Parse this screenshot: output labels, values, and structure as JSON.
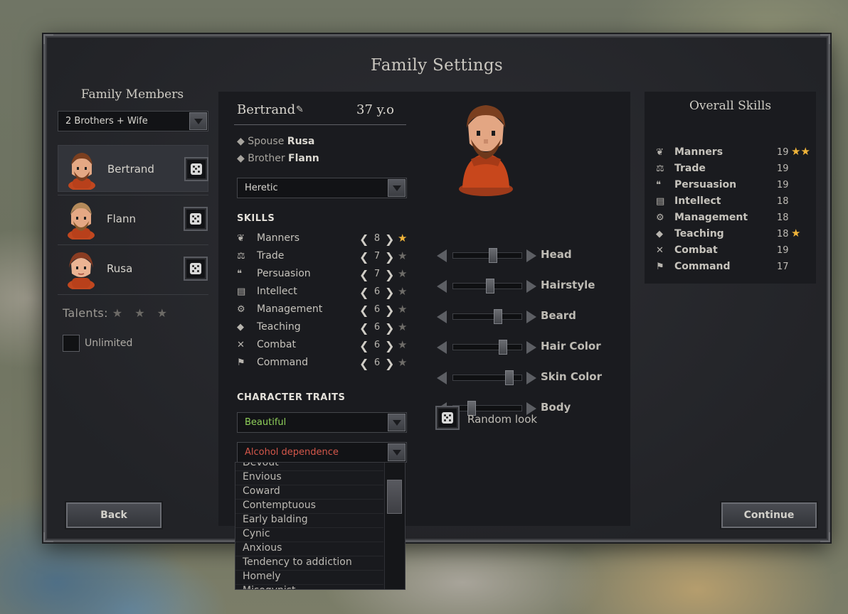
{
  "dialog": {
    "title": "Family Settings"
  },
  "family": {
    "header": "Family Members",
    "preset": "2 Brothers + Wife",
    "members": [
      {
        "name": "Bertrand",
        "active": true
      },
      {
        "name": "Flann",
        "active": false
      },
      {
        "name": "Rusa",
        "active": false
      }
    ],
    "talents_label": "Talents:",
    "talents_stars": "★ ★ ★",
    "unlimited_label": "Unlimited",
    "unlimited_checked": false
  },
  "character": {
    "name": "Bertrand",
    "age": "37 y.o",
    "relations": [
      {
        "role": "Spouse",
        "name": "Rusa"
      },
      {
        "role": "Brother",
        "name": "Flann"
      }
    ],
    "religion": "Heretic",
    "skills_header": "SKILLS",
    "skills": [
      {
        "name": "Manners",
        "icon": "manners-icon",
        "value": "8",
        "starred": true
      },
      {
        "name": "Trade",
        "icon": "trade-icon",
        "value": "7",
        "starred": false
      },
      {
        "name": "Persuasion",
        "icon": "persuasion-icon",
        "value": "7",
        "starred": false
      },
      {
        "name": "Intellect",
        "icon": "intellect-icon",
        "value": "6",
        "starred": false
      },
      {
        "name": "Management",
        "icon": "management-icon",
        "value": "6",
        "starred": false
      },
      {
        "name": "Teaching",
        "icon": "teaching-icon",
        "value": "6",
        "starred": false
      },
      {
        "name": "Combat",
        "icon": "combat-icon",
        "value": "6",
        "starred": false
      },
      {
        "name": "Command",
        "icon": "command-icon",
        "value": "6",
        "starred": false
      }
    ],
    "traits_header": "CHARACTER TRAITS",
    "trait1": "Beautiful",
    "trait2": "Alcohol dependence",
    "trait_options": [
      "Devout",
      "Envious",
      "Coward",
      "Contemptuous",
      "Early balding",
      "Cynic",
      "Anxious",
      "Tendency to addiction",
      "Homely",
      "Misogynist"
    ]
  },
  "appearance": {
    "sliders": [
      {
        "label": "Head",
        "level": 0.58
      },
      {
        "label": "Hairstyle",
        "level": 0.54
      },
      {
        "label": "Beard",
        "level": 0.65
      },
      {
        "label": "Hair Color",
        "level": 0.72
      },
      {
        "label": "Skin Color",
        "level": 0.82
      },
      {
        "label": "Body",
        "level": 0.28
      }
    ],
    "random_label": "Random look"
  },
  "overall": {
    "header": "Overall Skills",
    "skills": [
      {
        "name": "Manners",
        "value": "19",
        "stars": 2
      },
      {
        "name": "Trade",
        "value": "19",
        "stars": 0
      },
      {
        "name": "Persuasion",
        "value": "19",
        "stars": 0
      },
      {
        "name": "Intellect",
        "value": "18",
        "stars": 0
      },
      {
        "name": "Management",
        "value": "18",
        "stars": 0
      },
      {
        "name": "Teaching",
        "value": "18",
        "stars": 1
      },
      {
        "name": "Combat",
        "value": "19",
        "stars": 0
      },
      {
        "name": "Command",
        "value": "17",
        "stars": 0
      }
    ]
  },
  "buttons": {
    "back": "Back",
    "continue": "Continue"
  },
  "colors": {
    "star_gold": "#f0b43a",
    "trait_positive": "#8fcf5a",
    "trait_negative": "#d4574a"
  }
}
